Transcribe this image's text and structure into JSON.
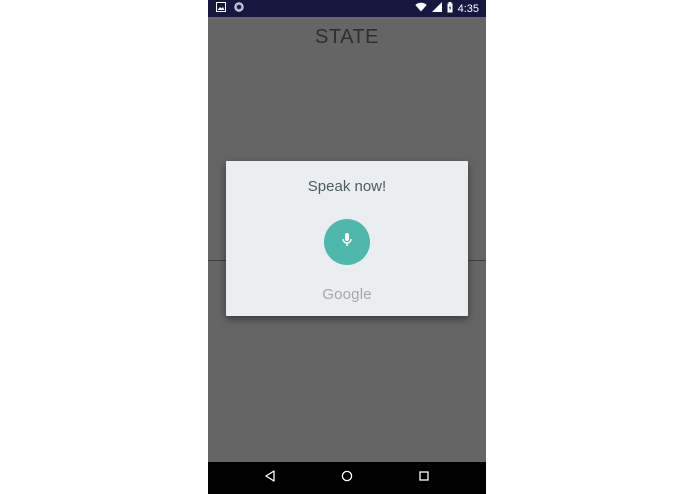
{
  "status_bar": {
    "time": "4:35",
    "icons_left": [
      "image-icon",
      "circle-notification-icon"
    ],
    "icons_right": [
      "wifi-icon",
      "cell-signal-icon",
      "battery-icon"
    ]
  },
  "app": {
    "title": "STATE"
  },
  "voice_dialog": {
    "prompt": "Speak now!",
    "mic_icon": "microphone-icon",
    "brand": "Google"
  },
  "nav_bar": {
    "buttons": [
      "back-icon",
      "home-icon",
      "recents-icon"
    ]
  },
  "colors": {
    "status_bar": "#16163f",
    "scrim": "#656565",
    "dialog": "#ebeef0",
    "mic_button": "#4fb7ac",
    "prompt_text": "#4d5a61",
    "brand_text": "#a3a8ab"
  }
}
